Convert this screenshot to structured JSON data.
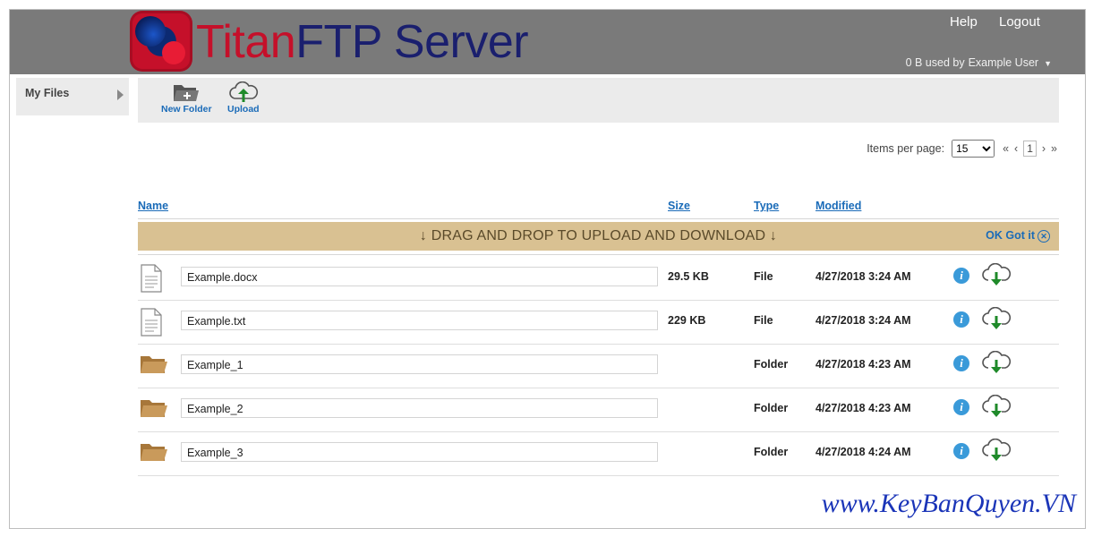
{
  "app": {
    "logo_part1": "Titan",
    "logo_part2": "FTP Server"
  },
  "header": {
    "help_label": "Help",
    "logout_label": "Logout",
    "usage_text": "0 B used by",
    "user_name": "Example User"
  },
  "sidebar": {
    "items": [
      {
        "label": "My Files"
      }
    ]
  },
  "toolbar": {
    "new_folder_label": "New Folder",
    "upload_label": "Upload"
  },
  "pager": {
    "items_per_page_label": "Items per page:",
    "items_per_page_value": "15",
    "current_page": "1",
    "first": "«",
    "prev": "‹",
    "next": "›",
    "last": "»"
  },
  "table": {
    "headers": {
      "name": "Name",
      "size": "Size",
      "type": "Type",
      "modified": "Modified"
    },
    "banner_text": "↓ DRAG AND DROP TO UPLOAD AND DOWNLOAD ↓",
    "banner_ok": "OK Got it",
    "rows": [
      {
        "name": "Example.docx",
        "size": "29.5 KB",
        "type": "File",
        "modified": "4/27/2018 3:24 AM",
        "icon": "document-icon"
      },
      {
        "name": "Example.txt",
        "size": "229 KB",
        "type": "File",
        "modified": "4/27/2018 3:24 AM",
        "icon": "document-icon"
      },
      {
        "name": "Example_1",
        "size": "",
        "type": "Folder",
        "modified": "4/27/2018 4:23 AM",
        "icon": "folder-icon"
      },
      {
        "name": "Example_2",
        "size": "",
        "type": "Folder",
        "modified": "4/27/2018 4:23 AM",
        "icon": "folder-icon"
      },
      {
        "name": "Example_3",
        "size": "",
        "type": "Folder",
        "modified": "4/27/2018 4:24 AM",
        "icon": "folder-icon"
      }
    ]
  },
  "watermark": "www.KeyBanQuyen.VN",
  "colors": {
    "header_bg": "#7a7a7a",
    "link": "#1a6bb8",
    "banner_bg": "#d9c192",
    "folder": "#b8894a",
    "download_arrow": "#1f8a2a"
  }
}
